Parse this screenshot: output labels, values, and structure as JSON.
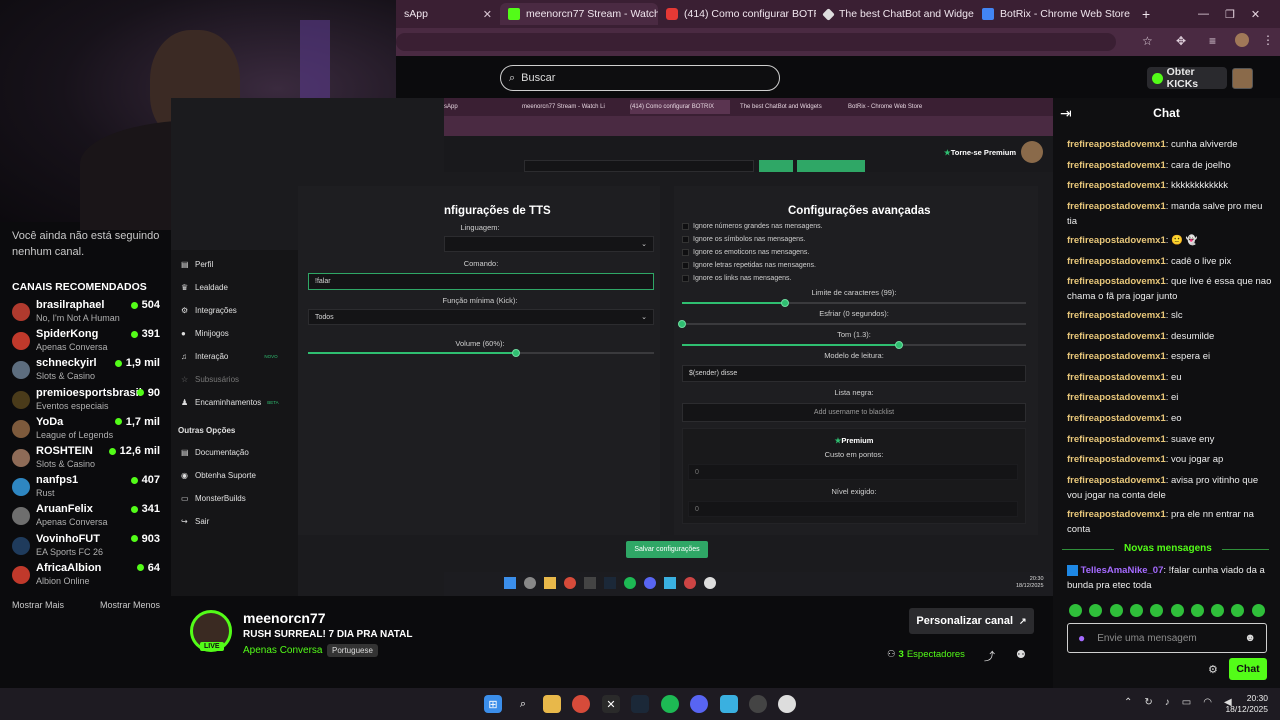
{
  "browser": {
    "tabs": [
      {
        "label": "sApp"
      },
      {
        "label": "meenorcn77 Stream - Watch Li"
      },
      {
        "label": "(414) Como configurar BOTRIX"
      },
      {
        "label": "The best ChatBot and Widgets"
      },
      {
        "label": "BotRix - Chrome Web Store"
      }
    ],
    "new_tab": "+"
  },
  "header": {
    "search_placeholder": "Buscar",
    "kicks_label": "Obter KICKs"
  },
  "sidebar": {
    "following_empty": "Você ainda não está seguindo nenhum canal.",
    "recommended_title": "CANAIS RECOMENDADOS",
    "channels": [
      {
        "name": "brasilraphael",
        "category": "No, I'm Not A Human",
        "viewers": "504",
        "color": "#b03a2e"
      },
      {
        "name": "SpiderKong",
        "category": "Apenas Conversa",
        "viewers": "391",
        "color": "#c0392b"
      },
      {
        "name": "schneckyirl",
        "category": "Slots & Casino",
        "viewers": "1,9 mil",
        "color": "#5d6d7e"
      },
      {
        "name": "premioesportsbrasil",
        "category": "Eventos especiais",
        "viewers": "90",
        "color": "#4a3b1a"
      },
      {
        "name": "YoDa",
        "category": "League of Legends",
        "viewers": "1,7 mil",
        "color": "#7d5a3c"
      },
      {
        "name": "ROSHTEIN",
        "category": "Slots & Casino",
        "viewers": "12,6 mil",
        "color": "#8e6b57"
      },
      {
        "name": "nanfps1",
        "category": "Rust",
        "viewers": "407",
        "color": "#2e86c1"
      },
      {
        "name": "AruanFelix",
        "category": "Apenas Conversa",
        "viewers": "341",
        "color": "#6e6e6e"
      },
      {
        "name": "VovinhoFUT",
        "category": "EA Sports FC 26",
        "viewers": "903",
        "color": "#1f3b5c"
      },
      {
        "name": "AfricaAlbion",
        "category": "Albion Online",
        "viewers": "64",
        "color": "#c0392b"
      }
    ],
    "show_more": "Mostrar Mais",
    "show_less": "Mostrar Menos"
  },
  "stream_capture": {
    "inner_tabs": [
      {
        "label": "sApp"
      },
      {
        "label": "meenorcn77 Stream - Watch Li"
      },
      {
        "label": "(414) Como configurar BOTRIX"
      },
      {
        "label": "The best ChatBot and Widgets"
      },
      {
        "label": "BotRix - Chrome Web Store"
      }
    ],
    "premium_label": "Torne-se Premium",
    "nav": [
      {
        "label": "Perfil",
        "icon": "▤"
      },
      {
        "label": "Lealdade",
        "icon": "♛"
      },
      {
        "label": "Integrações",
        "icon": "⚙"
      },
      {
        "label": "Minijogos",
        "icon": "●"
      },
      {
        "label": "Interação",
        "icon": "♫"
      },
      {
        "label": "Subsusários",
        "icon": "☆"
      },
      {
        "label": "Encaminhamentos",
        "icon": "♟"
      }
    ],
    "nav_new_badge": "NOVO",
    "nav_beta_badge": "BETA",
    "other_options_title": "Outras Opções",
    "other_nav": [
      {
        "label": "Documentação",
        "icon": "▤"
      },
      {
        "label": "Obtenha Suporte",
        "icon": "◉"
      },
      {
        "label": "MonsterBuilds",
        "icon": "▭"
      },
      {
        "label": "Sair",
        "icon": "↪"
      }
    ],
    "tts": {
      "title": "nfigurações de TTS",
      "language_label": "Linguagem:",
      "command_label": "Comando:",
      "command_value": "!falar",
      "min_function_label": "Função mínima (Kick):",
      "min_function_value": "Todos",
      "volume_label": "Volume (60%):",
      "volume_fraction": 0.6
    },
    "advanced": {
      "title": "Configurações avançadas",
      "options": [
        "Ignore números grandes nas mensagens.",
        "Ignore os símbolos nas mensagens.",
        "Ignore os emoticons nas mensagens.",
        "Ignore letras repetidas nas mensagens.",
        "Ignore os links nas mensagens."
      ],
      "char_limit_label": "Limite de caracteres (99):",
      "char_limit_fraction": 0.3,
      "cooldown_label": "Esfriar (0 segundos):",
      "cooldown_fraction": 0.0,
      "tone_label": "Tom (1.3):",
      "tone_fraction": 0.63,
      "template_label": "Modelo de leitura:",
      "template_value": "$(sender) disse",
      "blacklist_label": "Lista negra:",
      "blacklist_placeholder": "Add username to blacklist",
      "premium_title": "Premium",
      "points_cost_label": "Custo em pontos:",
      "points_cost_value": "0",
      "level_label": "Nível exigido:",
      "level_value": "0"
    },
    "save_label": "Salvar configurações",
    "clock_time": "20:30",
    "clock_date": "18/12/2025"
  },
  "chat": {
    "title": "Chat",
    "messages": [
      {
        "user": "frefireapostadovemx1",
        "text": "cunha alviverde"
      },
      {
        "user": "frefireapostadovemx1",
        "text": "cara de joelho"
      },
      {
        "user": "frefireapostadovemx1",
        "text": "kkkkkkkkkkkk"
      },
      {
        "user": "frefireapostadovemx1",
        "text": "manda salve pro meu tia"
      },
      {
        "user": "frefireapostadovemx1",
        "text": "🙂 👻"
      },
      {
        "user": "frefireapostadovemx1",
        "text": "cadê o live pix"
      },
      {
        "user": "frefireapostadovemx1",
        "text": "que live é essa que nao chama o fã pra jogar junto"
      },
      {
        "user": "frefireapostadovemx1",
        "text": "slc"
      },
      {
        "user": "frefireapostadovemx1",
        "text": "desumilde"
      },
      {
        "user": "frefireapostadovemx1",
        "text": "espera ei"
      },
      {
        "user": "frefireapostadovemx1",
        "text": "eu"
      },
      {
        "user": "frefireapostadovemx1",
        "text": "ei"
      },
      {
        "user": "frefireapostadovemx1",
        "text": "eo"
      },
      {
        "user": "frefireapostadovemx1",
        "text": "suave eny"
      },
      {
        "user": "frefireapostadovemx1",
        "text": "vou jogar ap"
      },
      {
        "user": "frefireapostadovemx1",
        "text": "avisa pro vitinho que vou jogar na conta dele"
      },
      {
        "user": "frefireapostadovemx1",
        "text": "pra ele nn entrar na conta"
      }
    ],
    "new_messages": "Novas mensagens",
    "latest": {
      "user": "TellesAmaNike_07",
      "text": "!falar cunha viado da a bunda pra etec toda"
    },
    "input_placeholder": "Envie uma mensagem",
    "send_label": "Chat"
  },
  "channel": {
    "name": "meenorcn77",
    "title": "RUSH SURREAL! 7 DIA PRA NATAL",
    "category": "Apenas Conversa",
    "language": "Portuguese",
    "live_badge": "LIVE",
    "customize_label": "Personalizar canal",
    "viewers": "3",
    "viewers_label": "Espectadores"
  },
  "taskbar": {
    "time": "20:30",
    "date": "18/12/2025"
  },
  "colors": {
    "kick_green": "#53fc18",
    "chat_user": "#e8c77a",
    "botrix_green": "#2fbf71"
  }
}
